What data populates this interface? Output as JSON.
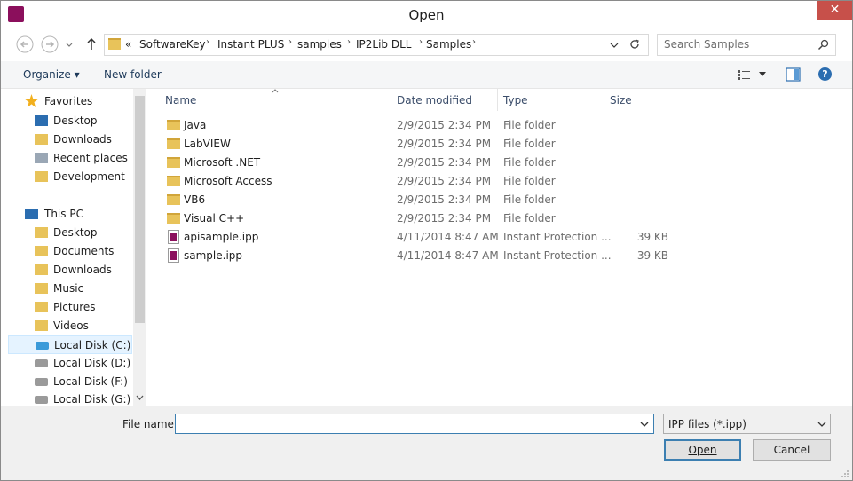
{
  "window": {
    "title": "Open",
    "close_glyph": "✕"
  },
  "address": {
    "overflow": "«",
    "crumbs": [
      "SoftwareKey",
      "Instant PLUS",
      "samples",
      "IP2Lib DLL",
      "Samples"
    ],
    "search_placeholder": "Search Samples"
  },
  "toolbar": {
    "organize": "Organize ▾",
    "new_folder": "New folder",
    "help": "?"
  },
  "nav": {
    "items": [
      {
        "label": "Favorites",
        "icon": "star-icon"
      },
      {
        "label": "Desktop",
        "icon": "desktop-icon"
      },
      {
        "label": "Downloads",
        "icon": "downloads-folder-icon"
      },
      {
        "label": "Recent places",
        "icon": "recent-places-icon"
      },
      {
        "label": "Development",
        "icon": "folder-icon"
      },
      {
        "label": "This PC",
        "icon": "computer-icon"
      },
      {
        "label": "Desktop",
        "icon": "desktop-folder-icon"
      },
      {
        "label": "Documents",
        "icon": "documents-folder-icon"
      },
      {
        "label": "Downloads",
        "icon": "downloads-folder-icon"
      },
      {
        "label": "Music",
        "icon": "music-folder-icon"
      },
      {
        "label": "Pictures",
        "icon": "pictures-folder-icon"
      },
      {
        "label": "Videos",
        "icon": "videos-folder-icon"
      },
      {
        "label": "Local Disk (C:)",
        "icon": "windows-drive-icon"
      },
      {
        "label": "Local Disk (D:)",
        "icon": "drive-icon"
      },
      {
        "label": "Local Disk (F:)",
        "icon": "drive-icon"
      },
      {
        "label": "Local Disk (G:)",
        "icon": "drive-icon"
      }
    ],
    "selected_index": 12
  },
  "columns": {
    "name": "Name",
    "date": "Date modified",
    "type": "Type",
    "size": "Size"
  },
  "files": [
    {
      "name": "Java",
      "date": "2/9/2015 2:34 PM",
      "type": "File folder",
      "size": "",
      "kind": "folder"
    },
    {
      "name": "LabVIEW",
      "date": "2/9/2015 2:34 PM",
      "type": "File folder",
      "size": "",
      "kind": "folder"
    },
    {
      "name": "Microsoft .NET",
      "date": "2/9/2015 2:34 PM",
      "type": "File folder",
      "size": "",
      "kind": "folder"
    },
    {
      "name": "Microsoft Access",
      "date": "2/9/2015 2:34 PM",
      "type": "File folder",
      "size": "",
      "kind": "folder"
    },
    {
      "name": "VB6",
      "date": "2/9/2015 2:34 PM",
      "type": "File folder",
      "size": "",
      "kind": "folder"
    },
    {
      "name": "Visual C++",
      "date": "2/9/2015 2:34 PM",
      "type": "File folder",
      "size": "",
      "kind": "folder"
    },
    {
      "name": "apisample.ipp",
      "date": "4/11/2014 8:47 AM",
      "type": "Instant Protection ...",
      "size": "39 KB",
      "kind": "ipp"
    },
    {
      "name": "sample.ipp",
      "date": "4/11/2014 8:47 AM",
      "type": "Instant Protection ...",
      "size": "39 KB",
      "kind": "ipp"
    }
  ],
  "footer": {
    "filename_label": "File name:",
    "filename_value": "",
    "filter_value": "IPP files (*.ipp)",
    "open_label": "Open",
    "cancel_label": "Cancel"
  }
}
